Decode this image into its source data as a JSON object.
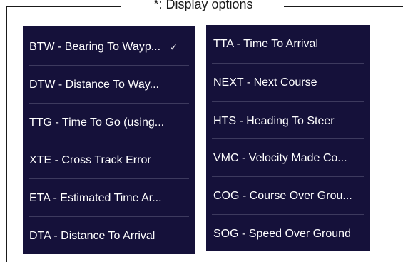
{
  "frame": {
    "title": "*: Display options"
  },
  "left_menu": {
    "items": [
      {
        "label": "BTW - Bearing To Wayp...",
        "checked": true
      },
      {
        "label": "DTW - Distance To Way..."
      },
      {
        "label": "TTG - Time To Go (using..."
      },
      {
        "label": "XTE - Cross Track Error"
      },
      {
        "label": "ETA - Estimated Time Ar..."
      },
      {
        "label": "DTA - Distance To Arrival"
      }
    ],
    "check_glyph": "✓"
  },
  "right_menu": {
    "items": [
      {
        "label": "TTA - Time To Arrival"
      },
      {
        "label": "NEXT - Next Course"
      },
      {
        "label": "HTS - Heading To Steer"
      },
      {
        "label": "VMC - Velocity Made Co..."
      },
      {
        "label": "COG - Course Over Grou..."
      },
      {
        "label": "SOG - Speed Over Ground"
      }
    ]
  },
  "colors": {
    "panel_background": "#15113a",
    "text": "#ffffff",
    "divider": "#3d3a5e",
    "frame": "#1a1a1a"
  }
}
